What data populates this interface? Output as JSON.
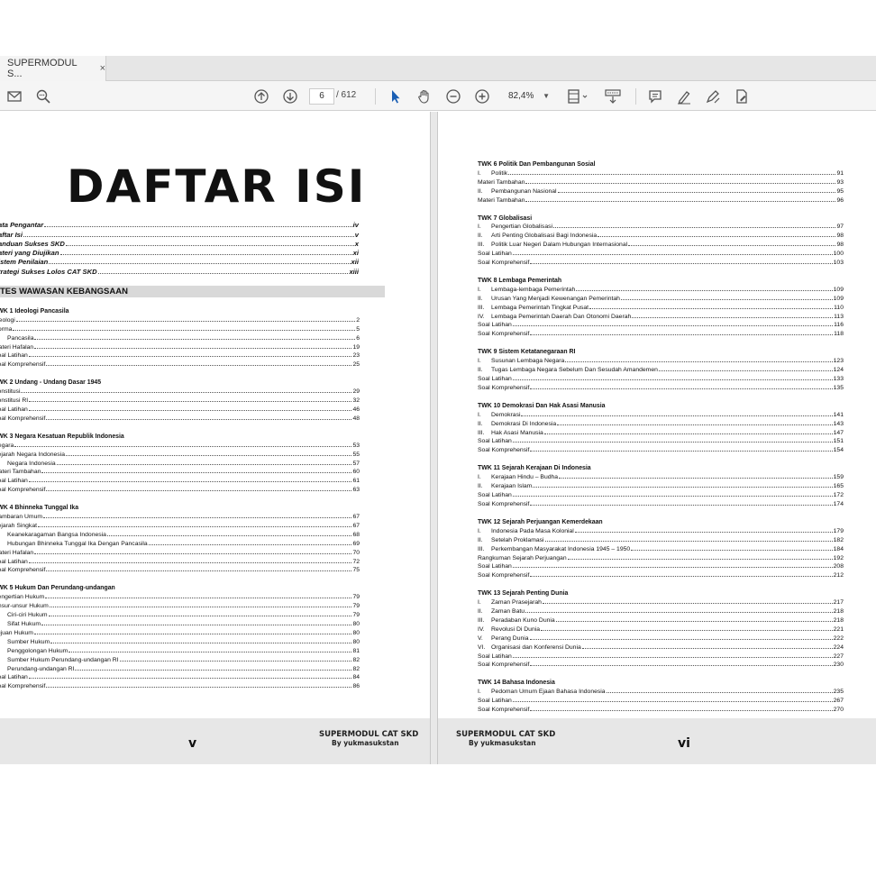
{
  "tab": {
    "title": "SUPERMODUL S...",
    "close": "×"
  },
  "toolbar": {
    "page_current": "6",
    "page_total": "/ 612",
    "zoom": "82,4%"
  },
  "left": {
    "title": "DAFTAR ISI",
    "front": [
      {
        "label": "ata Pengantar",
        "page": "iv"
      },
      {
        "label": "aftar Isi",
        "page": "v"
      },
      {
        "label": "anduan Sukses SKD",
        "page": "x"
      },
      {
        "label": "ateri yang Diujikan",
        "page": "xi"
      },
      {
        "label": "istem Penilaian",
        "page": "xii"
      },
      {
        "label": "trategi Sukses Lolos CAT SKD",
        "page": "xiii"
      }
    ],
    "banner": "TES WAWASAN KEBANGSAAN",
    "sections": [
      {
        "title": "TWK 1 Ideologi Pancasila",
        "rows": [
          {
            "n": "",
            "label": "Ideologi",
            "page": "2"
          },
          {
            "n": "",
            "label": "Norma",
            "page": "5"
          },
          {
            "n": "I.",
            "label": "Pancasila",
            "page": "6"
          },
          {
            "n": "",
            "label": "Materi Hafalan",
            "page": "19"
          },
          {
            "n": "",
            "label": "Soal Latihan",
            "page": "23"
          },
          {
            "n": "",
            "label": "Soal Komprehensif",
            "page": "25"
          }
        ]
      },
      {
        "title": "TWK 2 Undang - Undang  Dasar 1945",
        "rows": [
          {
            "n": "",
            "label": "Konstitusi",
            "page": "29"
          },
          {
            "n": "",
            "label": "Konstitusi RI",
            "page": "32"
          },
          {
            "n": "",
            "label": "Soal Latihan",
            "page": "46"
          },
          {
            "n": "",
            "label": "Soal Komprehensif",
            "page": "48"
          }
        ]
      },
      {
        "title": "TWK 3 Negara Kesatuan Republik Indonesia",
        "rows": [
          {
            "n": "",
            "label": "Negara",
            "page": "53"
          },
          {
            "n": "",
            "label": "Sejarah Negara Indonesia",
            "page": "55"
          },
          {
            "n": "I.",
            "label": "Negara Indonesia",
            "page": "57"
          },
          {
            "n": "",
            "label": "Materi Tambahan",
            "page": "60"
          },
          {
            "n": "",
            "label": "Soal Latihan",
            "page": "61"
          },
          {
            "n": "",
            "label": "Soal Komprehensif",
            "page": "63"
          }
        ]
      },
      {
        "title": "TWK 4 Bhinneka Tunggal Ika",
        "rows": [
          {
            "n": "",
            "label": "Gambaran Umum",
            "page": "67"
          },
          {
            "n": "",
            "label": "Sejarah Singkat",
            "page": "67"
          },
          {
            "n": "I.",
            "label": "Keanekaragaman Bangsa Indonesia",
            "page": "68"
          },
          {
            "n": "V.",
            "label": "Hubungan Bhinneka Tunggal Ika Dengan Pancasila",
            "page": "69"
          },
          {
            "n": "",
            "label": "Materi Hafalan",
            "page": "70"
          },
          {
            "n": "",
            "label": "Soal Latihan",
            "page": "72"
          },
          {
            "n": "",
            "label": "Soal Komprehensif",
            "page": "75"
          }
        ]
      },
      {
        "title": "TWK 5 Hukum Dan Perundang-undangan",
        "rows": [
          {
            "n": "",
            "label": "Pengertian Hukum",
            "page": "79"
          },
          {
            "n": "",
            "label": "Unsur-unsur Hukum",
            "page": "79"
          },
          {
            "n": "I.",
            "label": "Ciri-ciri Hukum",
            "page": "79"
          },
          {
            "n": "V.",
            "label": "Sifat Hukum",
            "page": "80"
          },
          {
            "n": "",
            "label": "Tujuan Hukum",
            "page": "80"
          },
          {
            "n": "I.",
            "label": "Sumber Hukum",
            "page": "80"
          },
          {
            "n": "II.",
            "label": "Penggolongan Hukum",
            "page": "81"
          },
          {
            "n": "III.",
            "label": "Sumber Hukum Perundang-undangan RI",
            "page": "82"
          },
          {
            "n": "X.",
            "label": "Perundang-undangan RI",
            "page": "82"
          },
          {
            "n": "",
            "label": "Soal Latihan",
            "page": "84"
          },
          {
            "n": "",
            "label": "Soal Komprehensif",
            "page": "86"
          }
        ]
      }
    ],
    "footer": {
      "roman": "v",
      "brand": "SUPERMODUL CAT SKD",
      "by": "By yukmasukstan"
    }
  },
  "right": {
    "sections": [
      {
        "title": "TWK 6 Politik Dan Pembangunan Sosial",
        "rows": [
          {
            "n": "I.",
            "label": "Politik",
            "page": "91"
          },
          {
            "n": "",
            "label": "Materi Tambahan",
            "page": "93"
          },
          {
            "n": "II.",
            "label": "Pembangunan Nasional",
            "page": "95"
          },
          {
            "n": "",
            "label": "Materi Tambahan",
            "page": "96"
          }
        ]
      },
      {
        "title": "TWK 7 Globalisasi",
        "rows": [
          {
            "n": "I.",
            "label": "Pengertian Globalisasi",
            "page": "97"
          },
          {
            "n": "II.",
            "label": "Arti Penting Globalisasi Bagi Indonesia",
            "page": "98"
          },
          {
            "n": "III.",
            "label": "Politik Luar Negeri Dalam Hubungan Internasional",
            "page": "98"
          },
          {
            "n": "",
            "label": "Soal Latihan",
            "page": "100"
          },
          {
            "n": "",
            "label": "Soal Komprehensif",
            "page": "103"
          }
        ]
      },
      {
        "title": "TWK 8 Lembaga Pemerintah",
        "rows": [
          {
            "n": "I.",
            "label": "Lembaga-lembaga Pemerintah",
            "page": "109"
          },
          {
            "n": "II.",
            "label": "Urusan Yang Menjadi Kewenangan Pemerintah",
            "page": "109"
          },
          {
            "n": "III.",
            "label": "Lembaga Pemerintah Tingkat Pusat",
            "page": "110"
          },
          {
            "n": "IV.",
            "label": "Lembaga Pemerintah Daerah Dan Otonomi Daerah",
            "page": "113"
          },
          {
            "n": "",
            "label": "Soal Latihan",
            "page": "116"
          },
          {
            "n": "",
            "label": "Soal Komprehensif",
            "page": "118"
          }
        ]
      },
      {
        "title": "TWK 9 Sistem Ketatanegaraan RI",
        "rows": [
          {
            "n": "I.",
            "label": "Susunan Lembaga Negara",
            "page": "123"
          },
          {
            "n": "II.",
            "label": "Tugas Lembaga Negara Sebelum Dan Sesudah Amandemen",
            "page": "124"
          },
          {
            "n": "",
            "label": "Soal Latihan",
            "page": "133"
          },
          {
            "n": "",
            "label": "Soal Komprehensif",
            "page": "135"
          }
        ]
      },
      {
        "title": "TWK 10 Demokrasi Dan Hak Asasi Manusia",
        "rows": [
          {
            "n": "I.",
            "label": "Demokrasi",
            "page": "141"
          },
          {
            "n": "II.",
            "label": "Demokrasi Di Indonesia",
            "page": "143"
          },
          {
            "n": "III.",
            "label": "Hak Asasi Manusia",
            "page": "147"
          },
          {
            "n": "",
            "label": "Soal Latihan",
            "page": "151"
          },
          {
            "n": "",
            "label": "Soal Komprehensif",
            "page": "154"
          }
        ]
      },
      {
        "title": "TWK 11 Sejarah Kerajaan Di Indonesia",
        "rows": [
          {
            "n": "I.",
            "label": "Kerajaan Hindu – Budha",
            "page": "159"
          },
          {
            "n": "II.",
            "label": "Kerajaan Islam",
            "page": "165"
          },
          {
            "n": "",
            "label": "Soal Latihan",
            "page": "172"
          },
          {
            "n": "",
            "label": "Soal Komprehensif",
            "page": "174"
          }
        ]
      },
      {
        "title": "TWK 12 Sejarah Perjuangan Kemerdekaan",
        "rows": [
          {
            "n": "I.",
            "label": "Indonesia Pada Masa Kolonial",
            "page": "179"
          },
          {
            "n": "II.",
            "label": "Setelah Proklamasi",
            "page": "182"
          },
          {
            "n": "III.",
            "label": "Perkembangan Masyarakat Indonesia 1945 – 1950",
            "page": "184"
          },
          {
            "n": "",
            "label": "Rangkuman Sejarah Perjuangan",
            "page": "192"
          },
          {
            "n": "",
            "label": "Soal Latihan",
            "page": "208"
          },
          {
            "n": "",
            "label": "Soal Komprehensif",
            "page": "212"
          }
        ]
      },
      {
        "title": "TWK 13 Sejarah Penting Dunia",
        "rows": [
          {
            "n": "I.",
            "label": "Zaman Prasejarah",
            "page": "217"
          },
          {
            "n": "II.",
            "label": "Zaman Batu",
            "page": "218"
          },
          {
            "n": "III.",
            "label": "Peradaban Kuno Dunia",
            "page": "218"
          },
          {
            "n": "IV.",
            "label": "Revolusi Di Dunia",
            "page": "221"
          },
          {
            "n": "V.",
            "label": "Perang Dunia",
            "page": "222"
          },
          {
            "n": "VI.",
            "label": "Organisasi dan Konferensi Dunia",
            "page": "224"
          },
          {
            "n": "",
            "label": "Soal Latihan",
            "page": "227"
          },
          {
            "n": "",
            "label": "Soal Komprehensif",
            "page": "230"
          }
        ]
      },
      {
        "title": "TWK 14 Bahasa Indonesia",
        "rows": [
          {
            "n": "I.",
            "label": "Pedoman Umum Ejaan Bahasa Indonesia",
            "page": "235"
          },
          {
            "n": "",
            "label": "Soal Latihan",
            "page": "267"
          },
          {
            "n": "",
            "label": "Soal Komprehensif",
            "page": "270"
          }
        ]
      }
    ],
    "footer": {
      "roman": "vi",
      "brand": "SUPERMODUL CAT SKD",
      "by": "By yukmasukstan"
    }
  }
}
